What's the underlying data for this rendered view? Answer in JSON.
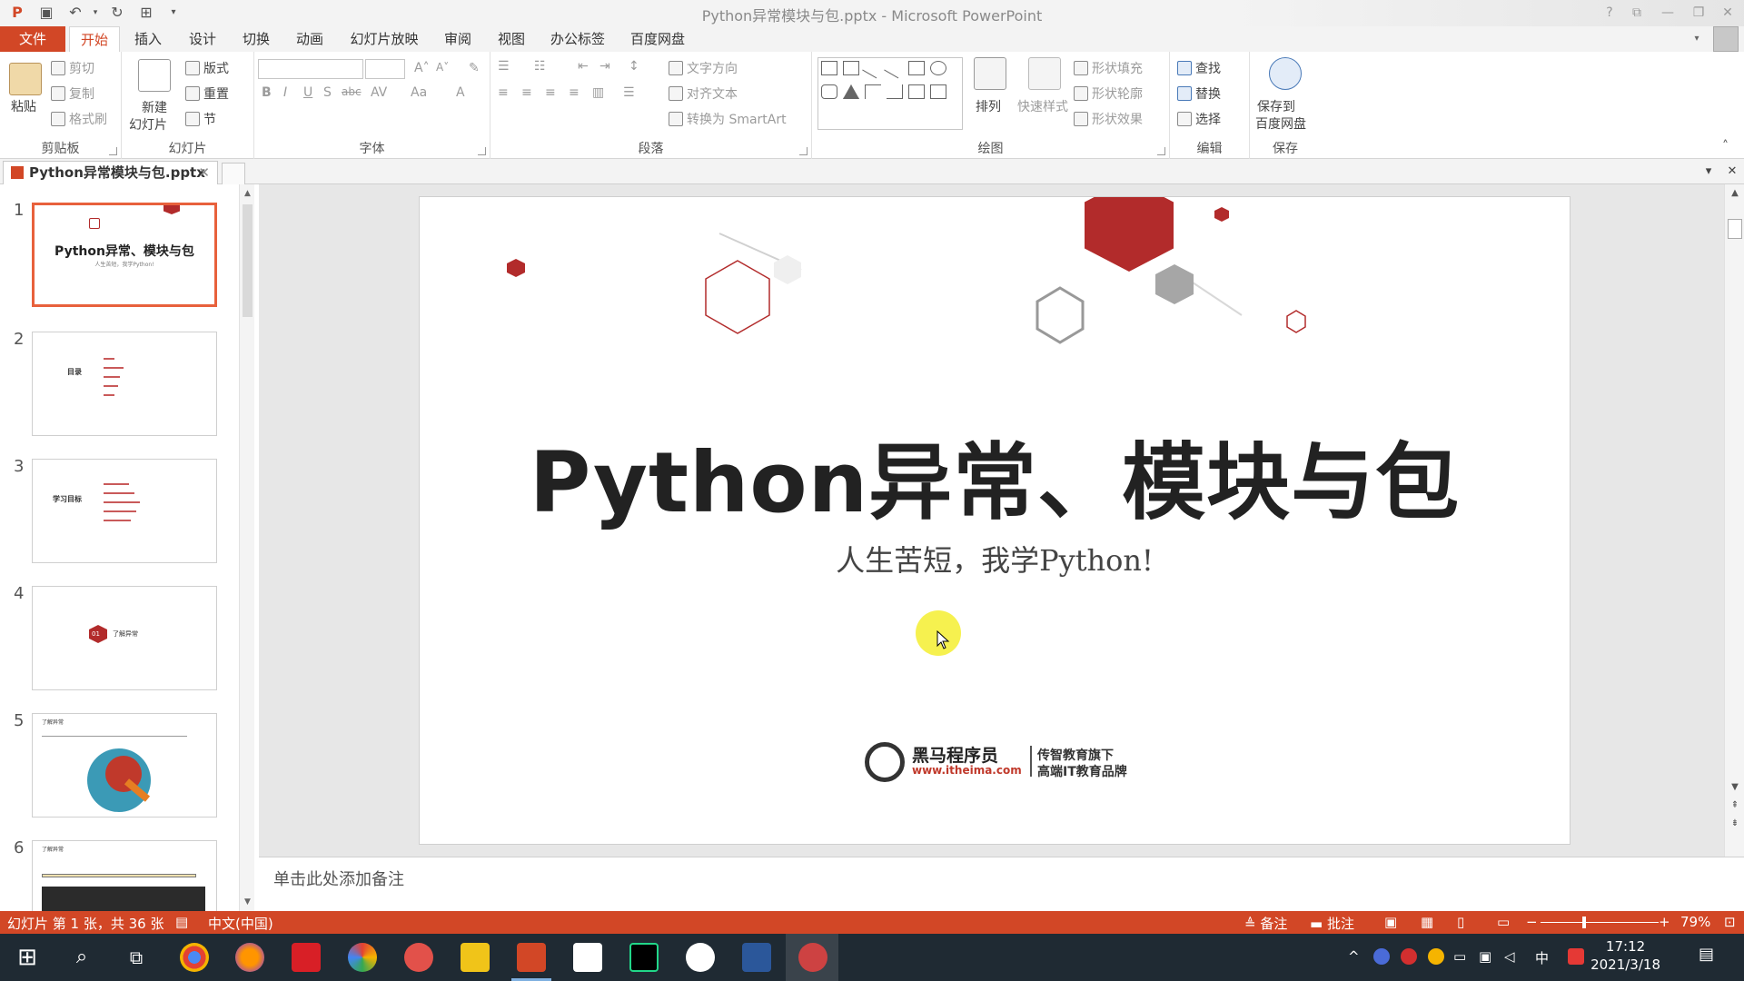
{
  "window": {
    "title": "Python异常模块与包.pptx - Microsoft PowerPoint"
  },
  "ribbon_tabs": [
    {
      "label": "文件"
    },
    {
      "label": "开始"
    },
    {
      "label": "插入"
    },
    {
      "label": "设计"
    },
    {
      "label": "切换"
    },
    {
      "label": "动画"
    },
    {
      "label": "幻灯片放映"
    },
    {
      "label": "审阅"
    },
    {
      "label": "视图"
    },
    {
      "label": "办公标签"
    },
    {
      "label": "百度网盘"
    }
  ],
  "ribbon": {
    "clipboard": {
      "paste": "粘贴",
      "cut": "剪切",
      "copy": "复制",
      "format_painter": "格式刷",
      "label": "剪贴板"
    },
    "slides": {
      "new_slide_1": "新建",
      "new_slide_2": "幻灯片",
      "layout": "版式",
      "reset": "重置",
      "section": "节",
      "label": "幻灯片"
    },
    "font": {
      "label": "字体",
      "bold": "B",
      "italic": "I",
      "underline": "U",
      "shadow": "S",
      "strike": "abc",
      "spacing": "AV",
      "case": "Aa",
      "color": "A"
    },
    "paragraph": {
      "text_direction": "文字方向",
      "align_text": "对齐文本",
      "smartart": "转换为 SmartArt",
      "label": "段落"
    },
    "drawing": {
      "arrange": "排列",
      "quick_styles": "快速样式",
      "shape_fill": "形状填充",
      "shape_outline": "形状轮廓",
      "shape_effects": "形状效果",
      "label": "绘图"
    },
    "editing": {
      "find": "查找",
      "replace": "替换",
      "select": "选择",
      "label": "编辑"
    },
    "save": {
      "save_to_1": "保存到",
      "save_to_2": "百度网盘",
      "label": "保存"
    }
  },
  "document_tab": {
    "name": "Python异常模块与包.pptx"
  },
  "thumbnails": [
    {
      "num": "1",
      "title": "Python异常、模块与包",
      "subtitle": "人生苦短，我学Python!"
    },
    {
      "num": "2",
      "title": "目录"
    },
    {
      "num": "3",
      "title": "学习目标"
    },
    {
      "num": "4",
      "badge": "01",
      "title": "了解异常"
    },
    {
      "num": "5",
      "title": "了解异常"
    },
    {
      "num": "6",
      "title": "了解异常"
    }
  ],
  "slide": {
    "title": "Python异常、模块与包",
    "subtitle": "人生苦短，我学Python!",
    "logo_brand": "黑马程序员",
    "logo_url": "www.itheima.com",
    "logo_tag1": "传智教育旗下",
    "logo_tag2": "高端IT教育品牌",
    "accent_color": "#b22b2b"
  },
  "notes": {
    "placeholder": "单击此处添加备注"
  },
  "statusbar": {
    "slide_info": "幻灯片 第 1 张，共 36 张",
    "language": "中文(中国)",
    "notes": "备注",
    "comments": "批注",
    "zoom": "79%",
    "zoom_minus": "−",
    "zoom_plus": "+"
  },
  "taskbar": {
    "time": "17:12",
    "date": "2021/3/18",
    "ime": "中"
  },
  "colors": {
    "brand": "#d24726",
    "accent": "#b22b2b",
    "taskbar": "#1f2a33"
  }
}
